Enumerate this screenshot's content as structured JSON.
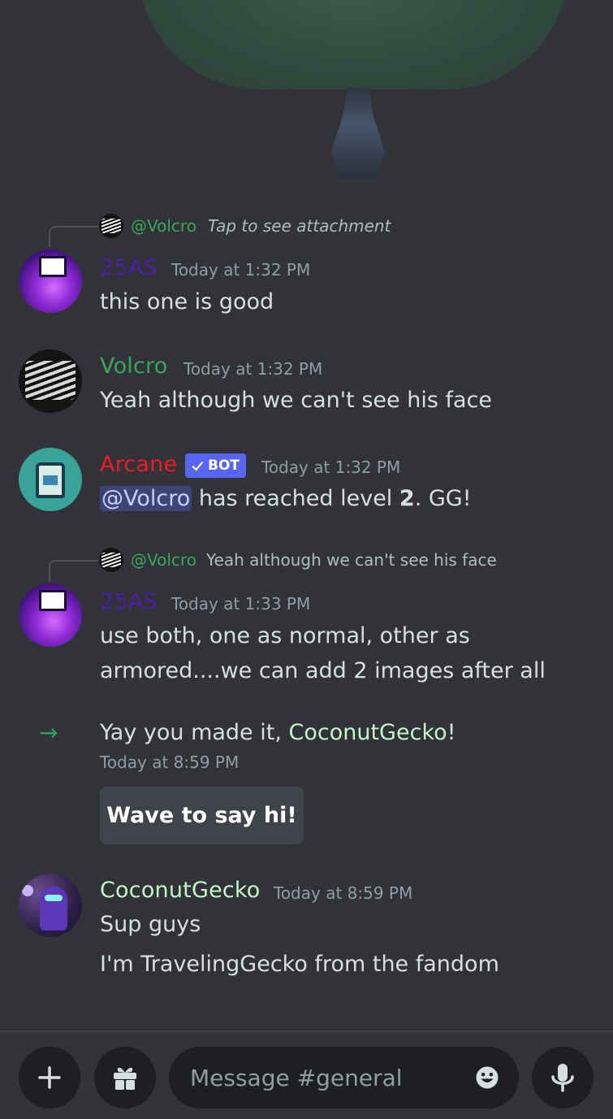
{
  "colors": {
    "background": "#313338",
    "name_25as": "#4b1fa3",
    "name_volcro": "#3ba55c",
    "name_arcane": "#ed1c24",
    "name_gecko": "#c4f5c7",
    "bot_tag": "#5865f2",
    "join_arrow": "#23a55a"
  },
  "reply1": {
    "mention": "@Volcro",
    "text": "Tap to see attachment",
    "avatar_icon": "volcro-avatar"
  },
  "msg1": {
    "author": "25AS",
    "timestamp": "Today at 1:32 PM",
    "text": "this one is good"
  },
  "msg2": {
    "author": "Volcro",
    "timestamp": "Today at 1:32 PM",
    "text": "Yeah although we can't see his face"
  },
  "msg3": {
    "author": "Arcane",
    "bot_label": "BOT",
    "bot_icon": "check-icon",
    "timestamp": "Today at 1:32 PM",
    "mention": "@Volcro",
    "text_before": " has reached level ",
    "level": "2",
    "text_after": ". GG!"
  },
  "reply2": {
    "mention": "@Volcro",
    "text": "Yeah although we can't see his face"
  },
  "msg4": {
    "author": "25AS",
    "timestamp": "Today at 1:33 PM",
    "line1": "use both, one as normal, other as",
    "line2": "armored....we can add 2 images after all"
  },
  "join": {
    "icon": "join-arrow-icon",
    "text_before": "Yay you made it, ",
    "name": "CoconutGecko",
    "text_after": "!",
    "timestamp": "Today at 8:59 PM",
    "wave_label": "Wave to say hi!"
  },
  "msg5": {
    "author": "CoconutGecko",
    "timestamp": "Today at 8:59 PM",
    "line1": "Sup guys",
    "line2": "I'm TravelingGecko from the fandom"
  },
  "composer": {
    "placeholder": "Message #general",
    "plus_icon": "plus-icon",
    "gift_icon": "gift-icon",
    "emoji_icon": "emoji-icon",
    "mic_icon": "microphone-icon"
  }
}
